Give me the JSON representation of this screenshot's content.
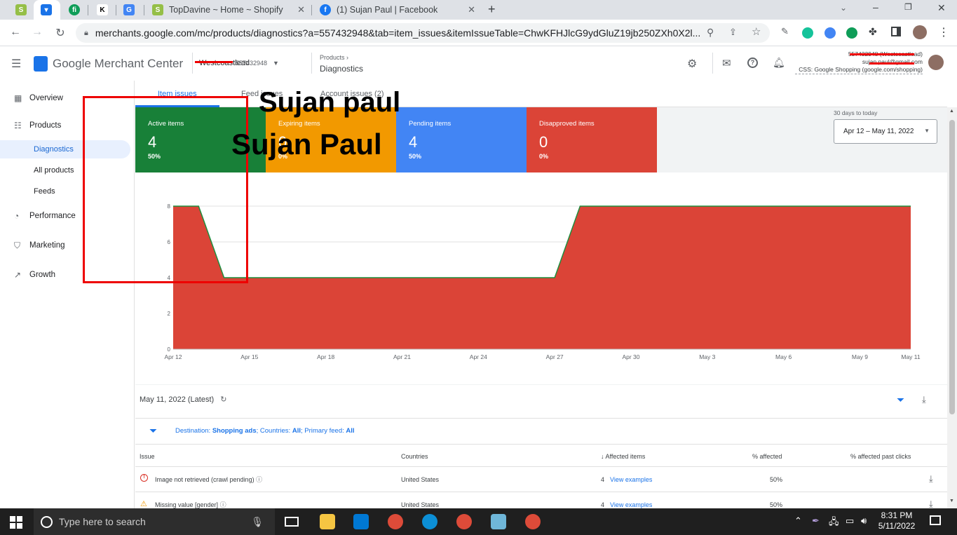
{
  "browser": {
    "tabs": [
      {
        "title": "",
        "favicon": "shopify-icon"
      },
      {
        "title": "",
        "favicon": "merchant-center-icon",
        "active": true
      },
      {
        "title": "",
        "favicon": "fi-icon"
      },
      {
        "title": "",
        "favicon": "k-icon"
      },
      {
        "title": "",
        "favicon": "translate-icon"
      },
      {
        "title": "TopDavine ~ Home ~ Shopify",
        "favicon": "shopify-icon"
      },
      {
        "title": "(1) Sujan Paul | Facebook",
        "favicon": "facebook-icon"
      }
    ],
    "url": "merchants.google.com/mc/products/diagnostics?a=557432948&tab=item_issues&itemIssueTable=ChwKFHJlcG9ydGluZ19jb250ZXh0X2l..."
  },
  "header": {
    "app_name": "Google Merchant Center",
    "account_name": "Westcoastlead",
    "account_id": "557432948",
    "breadcrumb_parent": "Products",
    "breadcrumb_current": "Diagnostics",
    "account_line1": "557432948 (Westcoastlead)",
    "account_line2": "sujan.paul@gmail.com",
    "account_line3": "CSS: Google Shopping (google.com/shopping)"
  },
  "sidebar": {
    "items": [
      {
        "label": "Overview",
        "icon": "dashboard-icon"
      },
      {
        "label": "Products",
        "icon": "list-icon"
      },
      {
        "label": "Diagnostics",
        "sub": true,
        "selected": true
      },
      {
        "label": "All products",
        "sub": true
      },
      {
        "label": "Feeds",
        "sub": true
      },
      {
        "label": "Performance",
        "icon": "performance-icon"
      },
      {
        "label": "Marketing",
        "icon": "marketing-icon"
      },
      {
        "label": "Growth",
        "icon": "growth-icon"
      }
    ]
  },
  "main_tabs": [
    "Item issues",
    "Feed issues",
    "Account issues (2)"
  ],
  "overlay": {
    "text1": "Sujan paul",
    "text2": "Sujan Paul"
  },
  "cards": [
    {
      "label": "Active items",
      "value": "4",
      "pct": "50%",
      "color": "#188038"
    },
    {
      "label": "Expiring items",
      "value": "0",
      "pct": "0%",
      "color": "#f29900"
    },
    {
      "label": "Pending items",
      "value": "4",
      "pct": "50%",
      "color": "#4285f4"
    },
    {
      "label": "Disapproved items",
      "value": "0",
      "pct": "0%",
      "color": "#db4437"
    }
  ],
  "date_range": {
    "caption": "30 days to today",
    "value": "Apr 12 – May 11, 2022"
  },
  "chart_data": {
    "type": "area",
    "x_ticks": [
      "Apr 12",
      "Apr 15",
      "Apr 18",
      "Apr 21",
      "Apr 24",
      "Apr 27",
      "Apr 30",
      "May 3",
      "May 6",
      "May 9",
      "May 11"
    ],
    "y_ticks": [
      "0",
      "2",
      "4",
      "6",
      "8"
    ],
    "ylim": [
      0,
      8
    ],
    "series": [
      {
        "color": "#db4437",
        "points": [
          [
            "Apr 12",
            8
          ],
          [
            "Apr 13",
            8
          ],
          [
            "Apr 14",
            4
          ],
          [
            "Apr 27",
            4
          ],
          [
            "Apr 28",
            8
          ],
          [
            "May 11",
            8
          ]
        ]
      }
    ]
  },
  "table": {
    "date_label": "May 11, 2022 (Latest)",
    "filter_prefix": "Destination:",
    "filter_dest": "Shopping ads",
    "filter_countries_prefix": "; Countries:",
    "filter_countries": "All",
    "filter_feed_prefix": "; Primary feed:",
    "filter_feed": "All",
    "headers": [
      "Issue",
      "Countries",
      "Affected items",
      "% affected",
      "% affected past clicks"
    ],
    "rows": [
      {
        "issue": "Image not retrieved (crawl pending)",
        "country": "United States",
        "count": "4",
        "link": "View examples",
        "pct": "50%",
        "icon": "error-icon"
      },
      {
        "issue": "Missing value [gender]",
        "country": "United States",
        "count": "4",
        "link": "View examples",
        "pct": "50%",
        "icon": "warning-icon"
      }
    ]
  },
  "taskbar": {
    "search_placeholder": "Type here to search",
    "time": "8:31 PM",
    "date": "5/11/2022"
  }
}
